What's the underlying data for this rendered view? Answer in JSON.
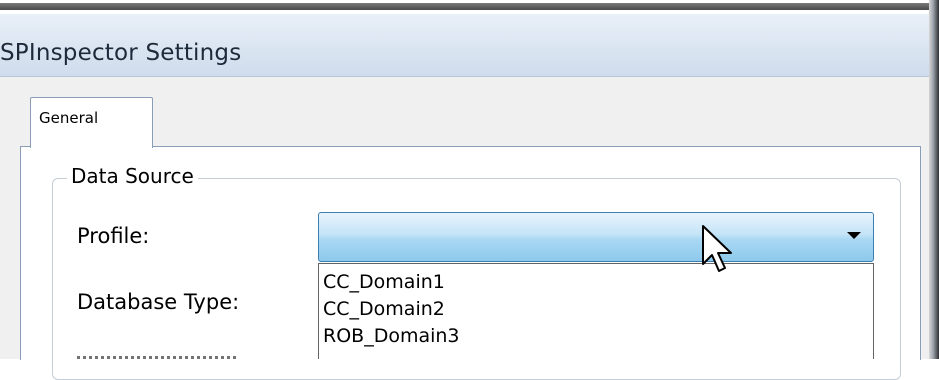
{
  "window": {
    "title": "SPInspector Settings"
  },
  "tabs": [
    {
      "label": "General",
      "selected": true
    }
  ],
  "data_source": {
    "group_label": "Data Source",
    "profile_label": "Profile:",
    "database_type_label": "Database Type:",
    "profile_value": "",
    "profile_options": [
      "CC_Domain1",
      "CC_Domain2",
      "ROB_Domain3"
    ]
  },
  "icons": {
    "combo_arrow": "chevron-down-icon",
    "cursor": "mouse-pointer-icon"
  },
  "colors": {
    "accent": "#3c7fb1",
    "title_bar": "#dbe6f2"
  }
}
